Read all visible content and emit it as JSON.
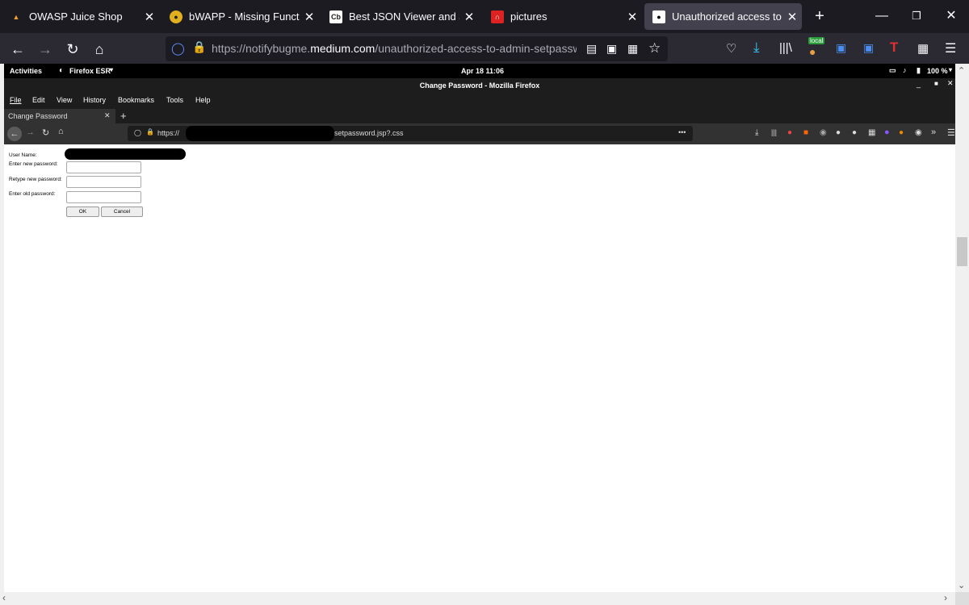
{
  "tabs": [
    {
      "label": "OWASP Juice Shop",
      "icon": "juice-shop-icon"
    },
    {
      "label": "bWAPP - Missing Functional L",
      "icon": "bee-icon"
    },
    {
      "label": "Best JSON Viewer and JSON I",
      "icon": "cb-icon",
      "icon_text": "Cb"
    },
    {
      "label": "pictures",
      "icon": "pictures-icon"
    },
    {
      "label": "Unauthorized access to admi",
      "icon": "medium-icon"
    }
  ],
  "url": {
    "prefix": "https://notifybugme.",
    "domain": "medium.com",
    "path": "/unauthorized-access-to-admin-setpassword-"
  },
  "badge_local": "local",
  "vm": {
    "activities": "Activities",
    "app_menu": "Firefox ESR",
    "clock": "Apr 18  11:06",
    "battery": "100 %",
    "window_title": "Change Password - Mozilla Firefox",
    "menu": [
      "File",
      "Edit",
      "View",
      "History",
      "Bookmarks",
      "Tools",
      "Help"
    ],
    "tab_title": "Change Password",
    "url_prefix": "https://",
    "url_suffix": "setpassword.jsp?.css",
    "url_more": "•••"
  },
  "form": {
    "user_name_label": "User Name:",
    "new_password_label": "Enter new password:",
    "retype_label": "Retype new password:",
    "old_password_label": "Enter old password:",
    "ok": "OK",
    "cancel": "Cancel"
  },
  "colors": {
    "accent": "#0df",
    "redaction": "#000000"
  }
}
